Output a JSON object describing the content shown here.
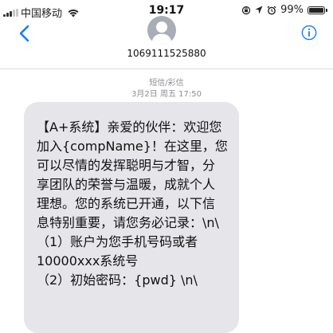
{
  "status_bar": {
    "carrier": "中国移动",
    "time": "19:17",
    "battery": "99%",
    "battery_level": 0.99,
    "icons": [
      "signal-icon",
      "wifi-icon",
      "orientation-lock-icon",
      "location-icon",
      "alarm-icon",
      "battery-icon"
    ]
  },
  "header": {
    "back_icon": "chevron-left-icon",
    "avatar_icon": "person-icon",
    "sender": "1069111525880",
    "info_icon": "info-icon",
    "accent_color": "#1a7cf5"
  },
  "message": {
    "type_label": "短信/彩信",
    "timestamp": "3月2日 周五 17:50",
    "bubble_color": "#e5e5ea",
    "lines": [
      "【A+系统】亲爱的伙伴：欢迎您",
      "加入{compName}！在这里，您",
      "可以尽情的发挥聪明与才智，分",
      "享团队的荣誉与温暖，成就个人",
      "理想。您的系统已开通，以下信",
      "息特别重要，请您务必记录：\\n\\",
      "（1）账户为您手机号码或者",
      "10000xxx系统号",
      "（2）初始密码：{pwd} \\n\\"
    ]
  }
}
